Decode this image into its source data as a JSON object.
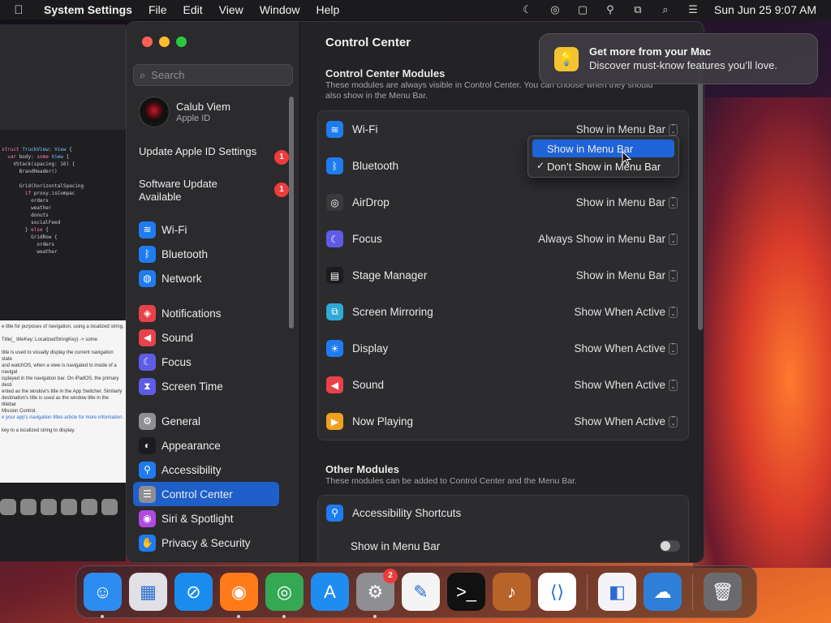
{
  "menubar": {
    "app_name": "System Settings",
    "menus": [
      "File",
      "Edit",
      "View",
      "Window",
      "Help"
    ],
    "clock": "Sun Jun 25  9:07 AM",
    "status_icons": [
      "moon-icon",
      "airdrop-icon",
      "stage-manager-icon",
      "accessibility-icon",
      "screen-mirroring-icon",
      "search-icon",
      "control-center-icon"
    ]
  },
  "window": {
    "search": {
      "placeholder": "Search"
    },
    "profile": {
      "name": "Calub Viem",
      "subtitle": "Apple ID"
    },
    "alerts": [
      {
        "label": "Update Apple ID Settings",
        "badge": "1"
      },
      {
        "label": "Software Update Available",
        "badge": "1"
      }
    ],
    "sidebar_groups": [
      [
        {
          "label": "Wi-Fi",
          "icon": "wifi-icon",
          "color": "#1f7cf0"
        },
        {
          "label": "Bluetooth",
          "icon": "bluetooth-icon",
          "color": "#1f7cf0"
        },
        {
          "label": "Network",
          "icon": "globe-icon",
          "color": "#1f7cf0"
        }
      ],
      [
        {
          "label": "Notifications",
          "icon": "bell-icon",
          "color": "#e8424a"
        },
        {
          "label": "Sound",
          "icon": "speaker-icon",
          "color": "#e8424a"
        },
        {
          "label": "Focus",
          "icon": "moon-icon",
          "color": "#5e5ce6"
        },
        {
          "label": "Screen Time",
          "icon": "hourglass-icon",
          "color": "#5e5ce6"
        }
      ],
      [
        {
          "label": "General",
          "icon": "gear-icon",
          "color": "#8e8e93"
        },
        {
          "label": "Appearance",
          "icon": "appearance-icon",
          "color": "#1c1c1e"
        },
        {
          "label": "Accessibility",
          "icon": "accessibility-icon",
          "color": "#1f7cf0"
        },
        {
          "label": "Control Center",
          "icon": "control-center-icon",
          "color": "#8e8e93",
          "selected": true
        },
        {
          "label": "Siri & Spotlight",
          "icon": "siri-icon",
          "color": "#b04adf"
        },
        {
          "label": "Privacy & Security",
          "icon": "hand-icon",
          "color": "#1f7cf0"
        }
      ]
    ]
  },
  "main": {
    "title": "Control Center",
    "modules_title": "Control Center Modules",
    "modules_desc": "These modules are always visible in Control Center. You can choose when they should also show in the Menu Bar.",
    "modules": [
      {
        "label": "Wi-Fi",
        "icon": "wifi-icon",
        "color": "#1f7cf0",
        "value": "Show in Menu Bar"
      },
      {
        "label": "Bluetooth",
        "icon": "bluetooth-icon",
        "color": "#1f7cf0",
        "value": ""
      },
      {
        "label": "AirDrop",
        "icon": "airdrop-icon",
        "color": "#3a3a3c",
        "value": "Show in Menu Bar"
      },
      {
        "label": "Focus",
        "icon": "moon-icon",
        "color": "#5e5ce6",
        "value": "Always Show in Menu Bar"
      },
      {
        "label": "Stage Manager",
        "icon": "stage-manager-icon",
        "color": "#1c1c1e",
        "value": "Show in Menu Bar"
      },
      {
        "label": "Screen Mirroring",
        "icon": "screen-mirroring-icon",
        "color": "#31a8d6",
        "value": "Show When Active"
      },
      {
        "label": "Display",
        "icon": "sun-icon",
        "color": "#1f7cf0",
        "value": "Show When Active"
      },
      {
        "label": "Sound",
        "icon": "speaker-icon",
        "color": "#e8424a",
        "value": "Show When Active"
      },
      {
        "label": "Now Playing",
        "icon": "play-icon",
        "color": "#f0a020",
        "value": "Show When Active"
      }
    ],
    "other_title": "Other Modules",
    "other_desc": "These modules can be added to Control Center and the Menu Bar.",
    "other_modules": [
      {
        "label": "Accessibility Shortcuts",
        "icon": "accessibility-icon",
        "color": "#1f7cf0"
      }
    ],
    "other_toggle_label": "Show in Menu Bar",
    "other_toggle_on": false
  },
  "dropdown": {
    "items": [
      {
        "label": "Show in Menu Bar",
        "highlighted": true,
        "checked": false
      },
      {
        "label": "Don’t Show in Menu Bar",
        "highlighted": false,
        "checked": true
      }
    ]
  },
  "notification": {
    "title": "Get more from your Mac",
    "body": "Discover must-know features you’ll love.",
    "icon": "lightbulb-icon"
  },
  "dock": {
    "apps": [
      {
        "name": "finder-icon",
        "color": "#2d8cf0",
        "glyph": "☺",
        "running": true
      },
      {
        "name": "launchpad-icon",
        "color": "#e0e0e6",
        "glyph": "▦",
        "running": false
      },
      {
        "name": "safari-icon",
        "color": "#1a8cf0",
        "glyph": "⊘",
        "running": false
      },
      {
        "name": "firefox-icon",
        "color": "#ff7a18",
        "glyph": "◉",
        "running": true
      },
      {
        "name": "chrome-icon",
        "color": "#34a853",
        "glyph": "◎",
        "running": true
      },
      {
        "name": "app-store-icon",
        "color": "#1f8cf0",
        "glyph": "A",
        "running": false
      },
      {
        "name": "system-settings-icon",
        "color": "#8e8e93",
        "glyph": "⚙",
        "running": true,
        "badge": "2"
      },
      {
        "name": "textedit-icon",
        "color": "#f4f4f4",
        "glyph": "✎",
        "running": false
      },
      {
        "name": "terminal-icon",
        "color": "#111111",
        "glyph": ">_",
        "running": false
      },
      {
        "name": "garageband-icon",
        "color": "#b8632a",
        "glyph": "♪",
        "running": false
      },
      {
        "name": "vscode-icon",
        "color": "#ffffff",
        "glyph": "⟨⟩",
        "running": false
      }
    ],
    "apps2": [
      {
        "name": "visual-studio-icon",
        "color": "#f4f4f8",
        "glyph": "◧",
        "running": false
      },
      {
        "name": "weather-icon",
        "color": "#2f7fd8",
        "glyph": "☁",
        "running": false
      }
    ],
    "trash": {
      "name": "trash-icon",
      "color": "#6b6b6f",
      "glyph": "🗑"
    }
  }
}
